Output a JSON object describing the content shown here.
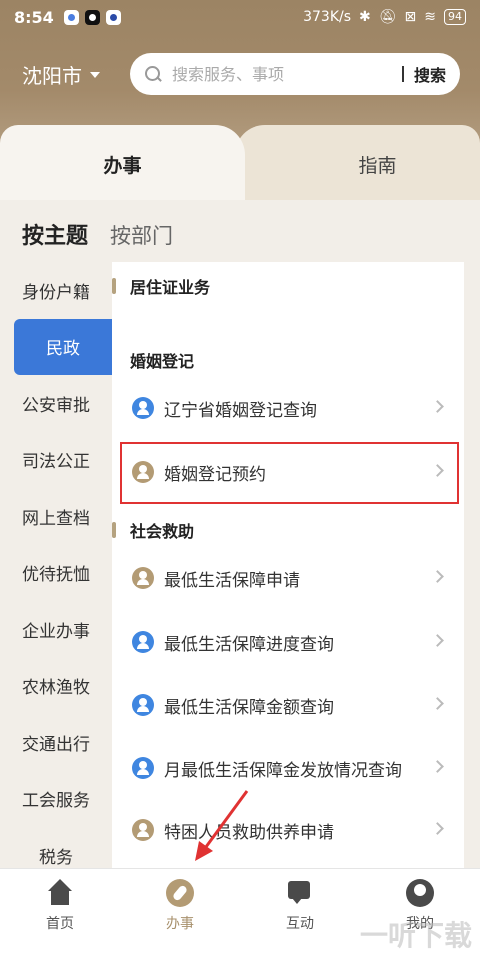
{
  "status_bar": {
    "time": "8:54",
    "network_speed": "373K/s",
    "battery": "94"
  },
  "header": {
    "city": "沈阳市",
    "search_placeholder": "搜索服务、事项",
    "search_button": "搜索"
  },
  "main_tabs": {
    "active": "办事",
    "other": "指南"
  },
  "sub_tabs": {
    "active": "按主题",
    "other": "按部门"
  },
  "sidebar": {
    "items": [
      {
        "label": "身份户籍"
      },
      {
        "label": "民政",
        "active": true
      },
      {
        "label": "公安审批"
      },
      {
        "label": "司法公正"
      },
      {
        "label": "网上查档"
      },
      {
        "label": "优待抚恤"
      },
      {
        "label": "企业办事"
      },
      {
        "label": "农林渔牧"
      },
      {
        "label": "交通出行"
      },
      {
        "label": "工会服务"
      },
      {
        "label": "税务"
      }
    ]
  },
  "list": {
    "sections": [
      {
        "title": "居住证业务"
      },
      {
        "title": "婚姻登记"
      },
      {
        "title": "社会救助"
      }
    ],
    "items": [
      {
        "label": "辽宁省婚姻登记查询",
        "icon": "blue"
      },
      {
        "label": "婚姻登记预约",
        "icon": "gold",
        "highlighted": true
      },
      {
        "label": "最低生活保障申请",
        "icon": "gold"
      },
      {
        "label": "最低生活保障进度查询",
        "icon": "blue"
      },
      {
        "label": "最低生活保障金额查询",
        "icon": "blue"
      },
      {
        "label": "月最低生活保障金发放情况查询",
        "icon": "blue"
      },
      {
        "label": "特困人员救助供养申请",
        "icon": "gold"
      }
    ]
  },
  "bottom_nav": {
    "items": [
      {
        "label": "首页"
      },
      {
        "label": "办事",
        "active": true
      },
      {
        "label": "互动"
      },
      {
        "label": "我的"
      }
    ]
  },
  "watermark": "一听下载",
  "colors": {
    "header": "#a38a6a",
    "accent_blue": "#3b78d8",
    "gold": "#b39b74",
    "highlight_red": "#e03232"
  }
}
